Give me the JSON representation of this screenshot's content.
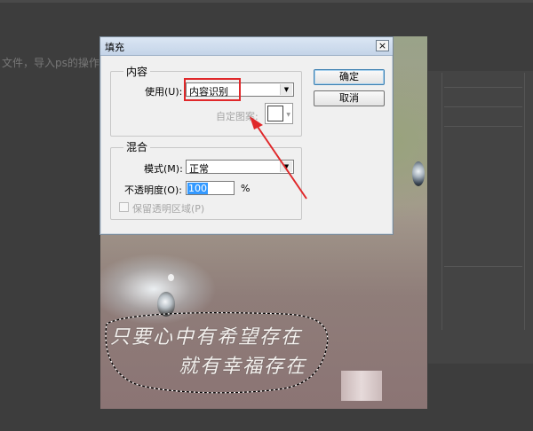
{
  "background": {
    "doc_tab_text": "文件，导入ps的操作"
  },
  "dialog": {
    "title": "填充",
    "close_symbol": "×",
    "content_group": {
      "legend": "内容",
      "use_label": "使用(U):",
      "use_value": "内容识别",
      "custom_pattern_label": "自定图案:"
    },
    "blend_group": {
      "legend": "混合",
      "mode_label": "模式(M):",
      "mode_value": "正常",
      "opacity_label": "不透明度(O):",
      "opacity_value": "100",
      "opacity_unit": "%",
      "preserve_label": "保留透明区域(P)"
    },
    "buttons": {
      "ok": "确定",
      "cancel": "取消"
    },
    "dropdown_arrow": "▼"
  },
  "photo": {
    "text_line1": "只要心中有希望存在",
    "text_line2": "就有幸福存在"
  },
  "colors": {
    "annotation_red": "#e0282a",
    "selection_highlight": "#3399ff"
  }
}
